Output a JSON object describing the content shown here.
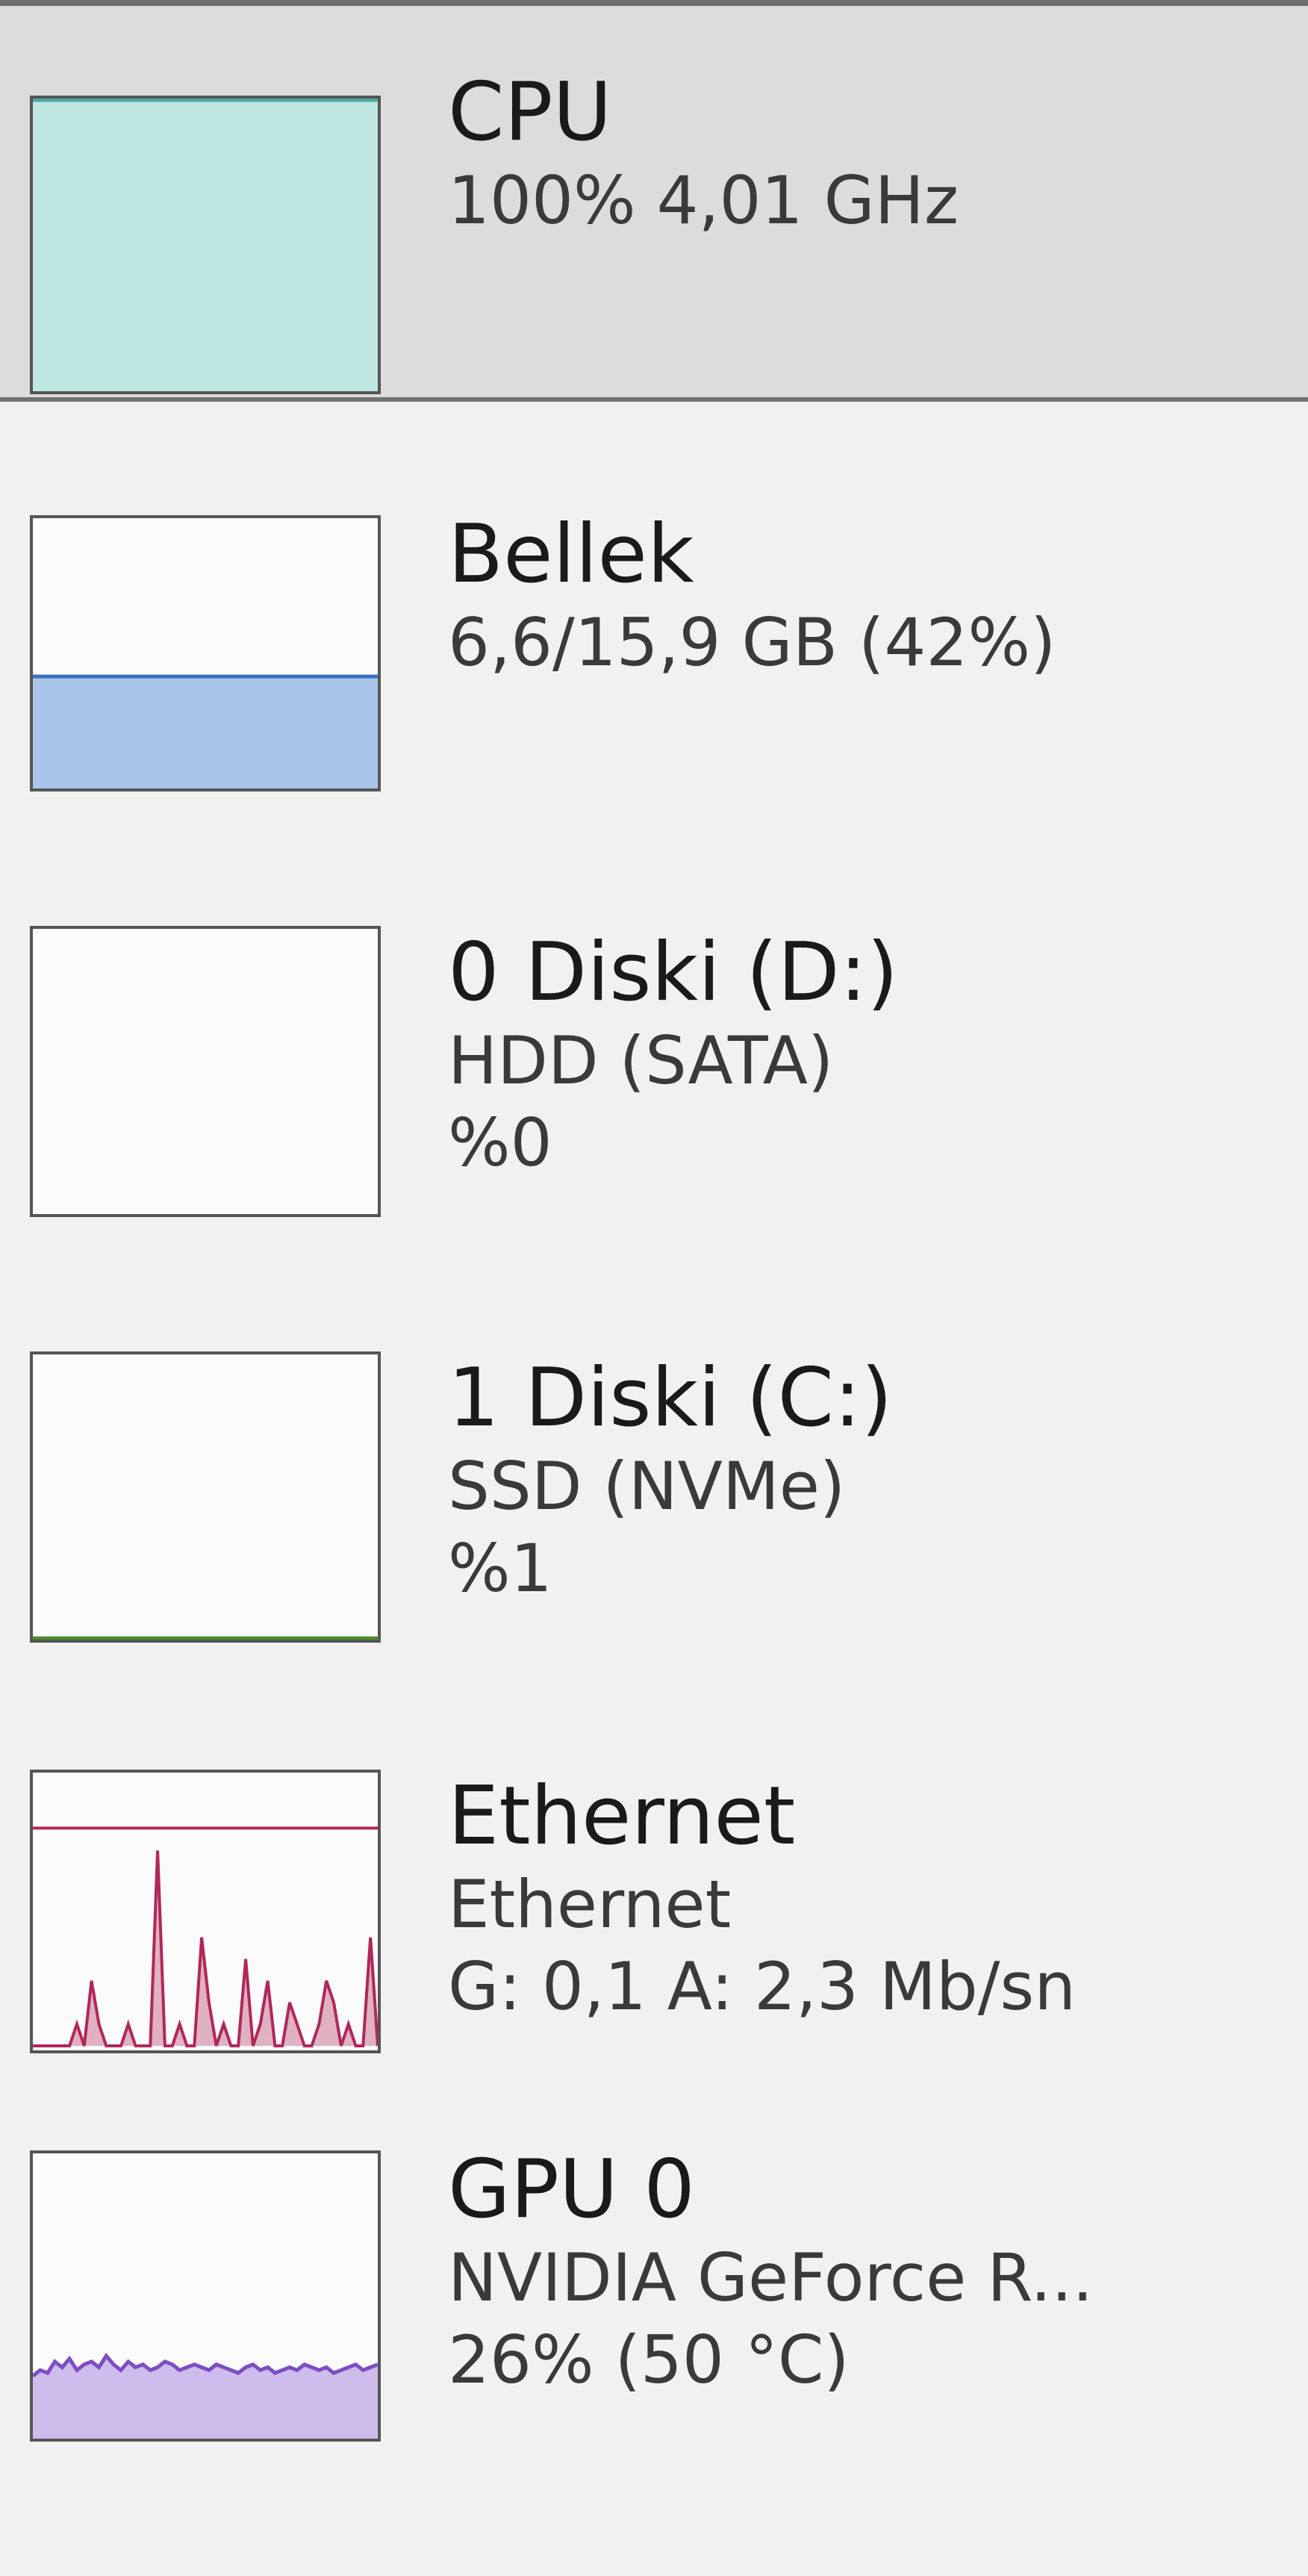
{
  "devices": [
    {
      "id": "cpu",
      "title": "CPU",
      "details": [
        "100% 4,01 GHz"
      ],
      "usage_percent": 100,
      "color": "#4aa8a0",
      "fill": "#bfe6e1"
    },
    {
      "id": "memory",
      "title": "Bellek",
      "details": [
        "6,6/15,9 GB (42%)"
      ],
      "usage_percent": 42,
      "color": "#3a72c4",
      "fill": "#a9c6ea"
    },
    {
      "id": "disk0",
      "title": "0 Diski (D:)",
      "details": [
        "HDD (SATA)",
        "%0"
      ],
      "usage_percent": 0,
      "color": "#4f8a2b"
    },
    {
      "id": "disk1",
      "title": "1 Diski (C:)",
      "details": [
        "SSD (NVMe)",
        "%1"
      ],
      "usage_percent": 1,
      "color": "#4f8a2b"
    },
    {
      "id": "ethernet",
      "title": "Ethernet",
      "details": [
        "Ethernet",
        "G: 0,1 A: 2,3 Mb/sn"
      ],
      "color": "#b0285a",
      "history": [
        0,
        0,
        0,
        0,
        0,
        0,
        1,
        0,
        3,
        1,
        0,
        0,
        0,
        1,
        0,
        0,
        0,
        9,
        0,
        0,
        1,
        0,
        0,
        5,
        2,
        0,
        1,
        0,
        0,
        4,
        0,
        1,
        3,
        0,
        0,
        2,
        1,
        0,
        0,
        1,
        3,
        2,
        0,
        1,
        0,
        0,
        5,
        0
      ]
    },
    {
      "id": "gpu0",
      "title": "GPU 0",
      "details": [
        "NVIDIA GeForce R...",
        "26% (50 °C)"
      ],
      "usage_percent": 26,
      "color": "#7d4ec4",
      "fill": "#c9b5ea",
      "history": [
        22,
        24,
        23,
        27,
        25,
        28,
        24,
        26,
        27,
        25,
        29,
        26,
        24,
        27,
        25,
        26,
        24,
        25,
        27,
        26,
        24,
        25,
        26,
        25,
        24,
        26,
        25,
        24,
        23,
        25,
        26,
        24,
        25,
        23,
        24,
        25,
        24,
        26,
        25,
        24,
        25,
        23,
        24,
        25,
        26,
        24,
        25,
        26
      ]
    }
  ]
}
